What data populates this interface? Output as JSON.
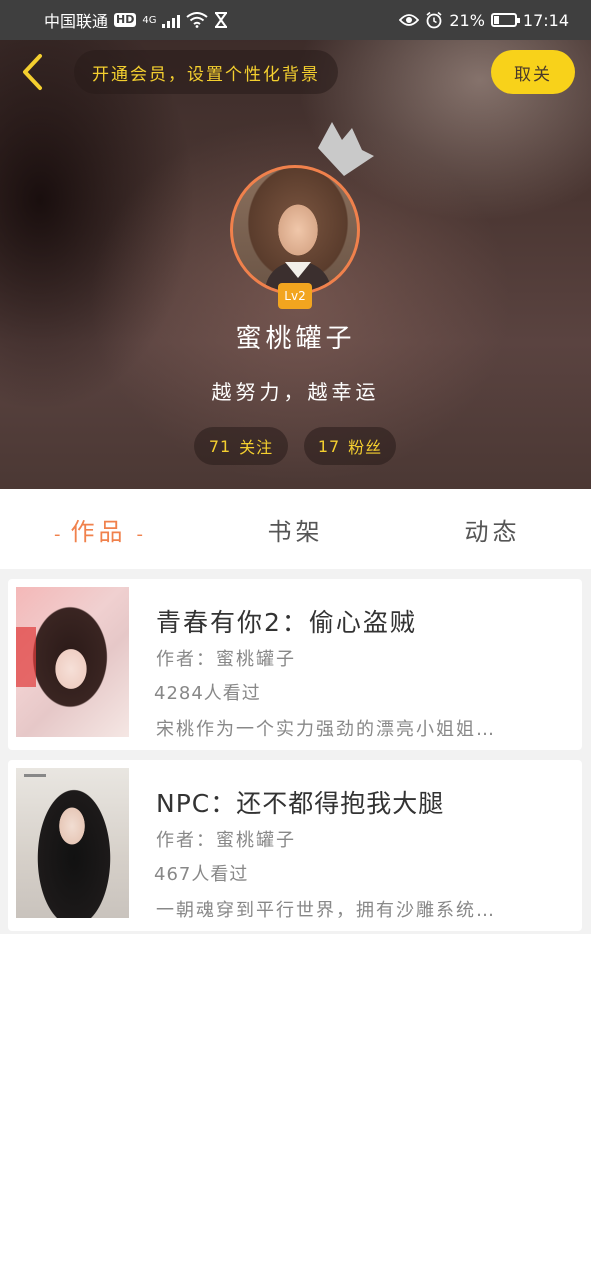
{
  "status_bar": {
    "carrier": "中国联通",
    "hd": "HD",
    "network": "4G",
    "battery_percent": "21%",
    "time": "17:14"
  },
  "header": {
    "vip_promo": "开通会员，设置个性化背景",
    "unfollow_label": "取关",
    "level_badge": "Lv2",
    "nickname": "蜜桃罐子",
    "motto": "越努力，越幸运",
    "following_count": "71",
    "following_label": "关注",
    "fans_count": "17",
    "fans_label": "粉丝",
    "accent_color": "#f8d21a"
  },
  "tabs": [
    {
      "label": "作品",
      "dash": "-",
      "active": true
    },
    {
      "label": "书架",
      "active": false
    },
    {
      "label": "动态",
      "active": false
    }
  ],
  "works": [
    {
      "title": "青春有你2：偷心盗贼",
      "author": "作者：蜜桃罐子",
      "views": "4284人看过",
      "desc": "宋桃作为一个实力强劲的漂亮小姐姐…"
    },
    {
      "title": "NPC：还不都得抱我大腿",
      "author": "作者：蜜桃罐子",
      "views": "467人看过",
      "desc": "一朝魂穿到平行世界，拥有沙雕系统…"
    }
  ]
}
